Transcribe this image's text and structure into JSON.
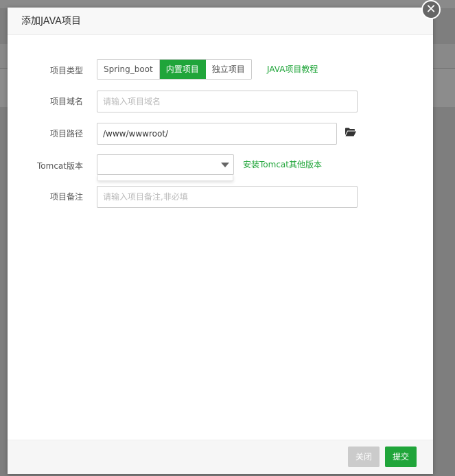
{
  "dialog": {
    "title": "添加JAVA项目",
    "close_symbol": "✕"
  },
  "form": {
    "project_type": {
      "label": "项目类型",
      "options": [
        "Spring_boot",
        "内置项目",
        "独立项目"
      ],
      "selected": "内置项目",
      "tutorial_link": "JAVA项目教程"
    },
    "domain": {
      "label": "项目域名",
      "value": "",
      "placeholder": "请输入项目域名"
    },
    "path": {
      "label": "项目路径",
      "value": "/www/wwwroot/",
      "icon": "folder-open-icon"
    },
    "tomcat": {
      "label": "Tomcat版本",
      "value": "",
      "install_link": "安装Tomcat其他版本"
    },
    "remark": {
      "label": "项目备注",
      "value": "",
      "placeholder": "请输入项目备注,非必填"
    }
  },
  "footer": {
    "close_label": "关闭",
    "submit_label": "提交"
  },
  "colors": {
    "accent": "#20a53a",
    "disabled": "#cbcbcb"
  }
}
